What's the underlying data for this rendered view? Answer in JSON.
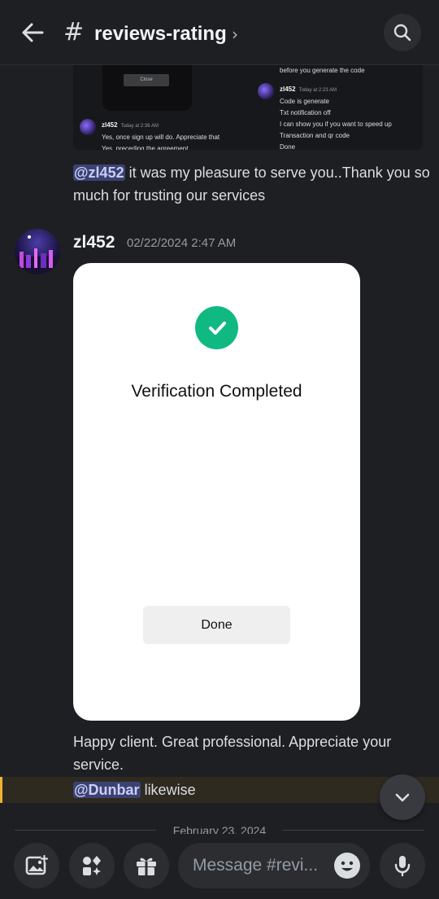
{
  "header": {
    "channel_name": "reviews-rating",
    "hash_symbol": "#",
    "chevron": "›"
  },
  "previous_image": {
    "close_label": "Close",
    "left_msg": {
      "author": "zl452",
      "time": "Today at 2:36 AM",
      "lines": [
        "Yes, once sign up will do. Appreciate that",
        "Yes, preceding the agreement."
      ]
    },
    "right_top_line": "before you generate the code",
    "right_msg": {
      "author": "zl452",
      "time": "Today at 2:23 AM",
      "lines": [
        "Code is generate",
        "Txt notification off",
        "I can show you if you want to speed up",
        "Transaction and qr code",
        "Done"
      ]
    }
  },
  "reply_message": {
    "mention": "@zl452",
    "text": " it was my pleasure to serve you..Thank you so much for trusting our services"
  },
  "message": {
    "author": "zl452",
    "timestamp": "02/22/2024 2:47 AM",
    "attachment": {
      "title": "Verification Completed",
      "button": "Done"
    },
    "text": "Happy client. Great professional. Appreciate your service."
  },
  "highlight_message": {
    "mention": "@Dunbar",
    "text": " likewise"
  },
  "date_divider": "February 23, 2024",
  "composer": {
    "placeholder": "Message #revi..."
  },
  "colors": {
    "background": "#1e1f22",
    "mention_bg": "#3c4270",
    "success_green": "#10b981",
    "highlight_bar": "#f0b232"
  },
  "icons": [
    "back-arrow-icon",
    "hash-icon",
    "search-icon",
    "image-icon",
    "apps-icon",
    "gift-icon",
    "emoji-icon",
    "microphone-icon",
    "chevron-down-icon",
    "checkmark-icon"
  ]
}
